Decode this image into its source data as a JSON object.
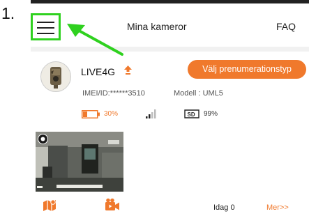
{
  "step": {
    "number": "1."
  },
  "header": {
    "title": "Mina kameror",
    "faq": "FAQ"
  },
  "camera": {
    "name": "LIVE4G",
    "plan_button": "Välj prenumerationstyp",
    "imei": "IMEI/ID:******3510",
    "model": "Modell : UML5",
    "battery": "30%",
    "sd_card": "99%",
    "today": "Idag 0",
    "more": "Mer>>"
  },
  "colors": {
    "accent": "#f0792c",
    "highlight": "#2fd11f"
  },
  "icons": [
    "menu-icon",
    "upgrade-icon",
    "battery-icon",
    "signal-icon",
    "sd-card-icon",
    "map-icon",
    "video-icon",
    "camera-icon"
  ]
}
